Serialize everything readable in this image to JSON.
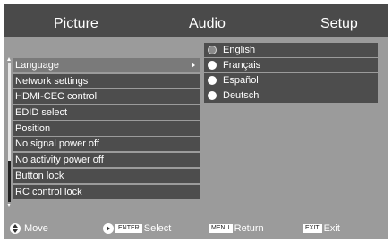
{
  "header": {
    "tabs": [
      {
        "label": "Picture"
      },
      {
        "label": "Audio"
      },
      {
        "label": "Setup"
      }
    ]
  },
  "menu": {
    "items": [
      {
        "label": "Language",
        "selected": true
      },
      {
        "label": "Network settings"
      },
      {
        "label": "HDMI-CEC control"
      },
      {
        "label": "EDID select"
      },
      {
        "label": "Position"
      },
      {
        "label": "No signal power off"
      },
      {
        "label": "No activity power off"
      },
      {
        "label": "Button lock"
      },
      {
        "label": "RC control lock"
      }
    ]
  },
  "submenu": {
    "options": [
      {
        "label": "English",
        "selected": true
      },
      {
        "label": "Français"
      },
      {
        "label": "Español"
      },
      {
        "label": "Deutsch"
      }
    ]
  },
  "footer": {
    "move_label": "Move",
    "select_key": "ENTER",
    "select_label": "Select",
    "return_key": "MENU",
    "return_label": "Return",
    "exit_key": "EXIT",
    "exit_label": "Exit"
  },
  "colors": {
    "background": "#9b9b9b",
    "header": "#4a4a4a",
    "item": "#4d4d4d",
    "item_selected": "#7a7a7a"
  },
  "icons": [
    "navigation-arrows-icon",
    "enter-icon",
    "menu-icon",
    "exit-icon",
    "submenu-arrow-icon"
  ]
}
